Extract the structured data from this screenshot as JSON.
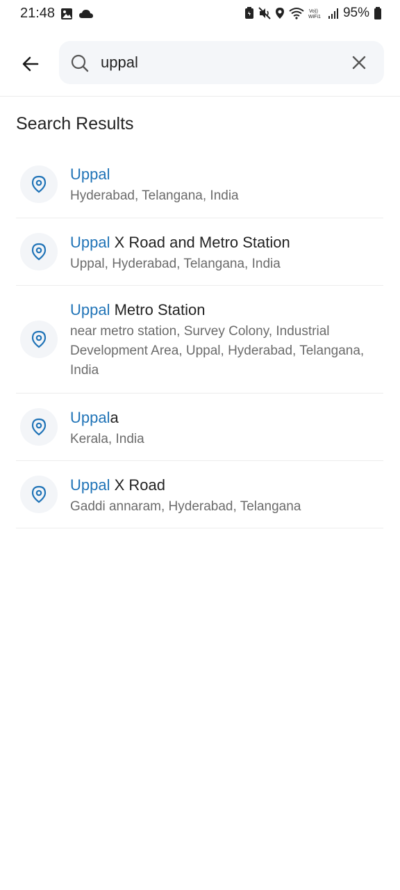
{
  "status_bar": {
    "time": "21:48",
    "battery": "95%",
    "icons_left": [
      "image-icon",
      "cloud-icon"
    ],
    "icons_right": [
      "battery-saver-icon",
      "mute-icon",
      "location-icon",
      "wifi-icon",
      "volte-icon",
      "signal-icon",
      "battery-icon"
    ]
  },
  "search": {
    "value": "uppal",
    "back_icon": "arrow-left-icon",
    "search_icon": "search-icon",
    "clear_icon": "close-icon"
  },
  "results_title": "Search Results",
  "accent_color": "#1f73b7",
  "results": [
    {
      "highlight": "Uppal",
      "rest": "",
      "subtitle": "Hyderabad, Telangana, India"
    },
    {
      "highlight": "Uppal",
      "rest": " X Road and Metro Station",
      "subtitle": "Uppal, Hyderabad, Telangana, India"
    },
    {
      "highlight": "Uppal",
      "rest": " Metro Station",
      "subtitle": "near metro station, Survey Colony, Industrial Development Area, Uppal, Hyderabad, Telangana, India"
    },
    {
      "highlight": "Uppal",
      "rest": "a",
      "subtitle": "Kerala, India"
    },
    {
      "highlight": "Uppal",
      "rest": " X Road",
      "subtitle": "Gaddi annaram, Hyderabad, Telangana"
    }
  ]
}
